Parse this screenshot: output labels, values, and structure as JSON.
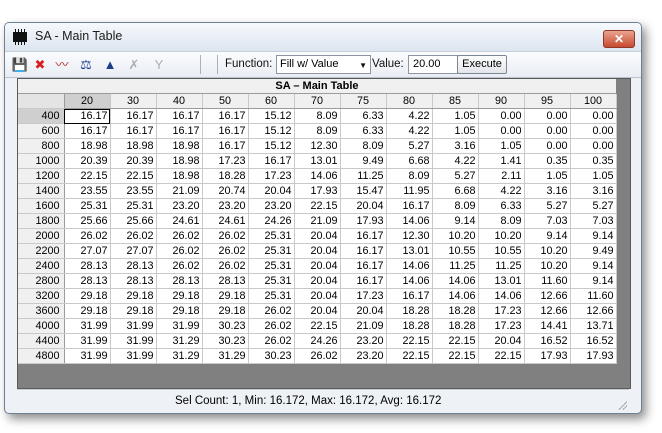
{
  "window": {
    "title": "SA - Main Table",
    "close_label": "✕"
  },
  "toolbar": {
    "buttons": [
      {
        "name": "save-button",
        "icon": "save-icon",
        "glyph": "💾"
      },
      {
        "name": "delete-button",
        "icon": "red-x-icon",
        "glyph": "✖"
      },
      {
        "name": "graph-button",
        "icon": "graph-icon",
        "glyph": "〰"
      },
      {
        "name": "balance-button",
        "icon": "scale-icon",
        "glyph": "⚖"
      },
      {
        "name": "triangle-button",
        "icon": "triangle-icon",
        "glyph": "▲"
      },
      {
        "name": "disabled-a-button",
        "icon": "ax-icon",
        "glyph": "✗"
      },
      {
        "name": "disabled-y-button",
        "icon": "y-icon",
        "glyph": "Y"
      }
    ],
    "function_label": "Function:",
    "function_value": "Fill w/ Value",
    "value_label": "Value:",
    "value_input": "20.00",
    "execute_label": "Execute"
  },
  "table": {
    "title": "SA – Main Table",
    "columns": [
      "20",
      "30",
      "40",
      "50",
      "60",
      "70",
      "75",
      "80",
      "85",
      "90",
      "95",
      "100"
    ],
    "rows": [
      {
        "label": "400",
        "values": [
          "16.17",
          "16.17",
          "16.17",
          "16.17",
          "15.12",
          "8.09",
          "6.33",
          "4.22",
          "1.05",
          "0.00",
          "0.00",
          "0.00"
        ]
      },
      {
        "label": "600",
        "values": [
          "16.17",
          "16.17",
          "16.17",
          "16.17",
          "15.12",
          "8.09",
          "6.33",
          "4.22",
          "1.05",
          "0.00",
          "0.00",
          "0.00"
        ]
      },
      {
        "label": "800",
        "values": [
          "18.98",
          "18.98",
          "18.98",
          "16.17",
          "15.12",
          "12.30",
          "8.09",
          "5.27",
          "3.16",
          "1.05",
          "0.00",
          "0.00"
        ]
      },
      {
        "label": "1000",
        "values": [
          "20.39",
          "20.39",
          "18.98",
          "17.23",
          "16.17",
          "13.01",
          "9.49",
          "6.68",
          "4.22",
          "1.41",
          "0.35",
          "0.35"
        ]
      },
      {
        "label": "1200",
        "values": [
          "22.15",
          "22.15",
          "18.98",
          "18.28",
          "17.23",
          "14.06",
          "11.25",
          "8.09",
          "5.27",
          "2.11",
          "1.05",
          "1.05"
        ]
      },
      {
        "label": "1400",
        "values": [
          "23.55",
          "23.55",
          "21.09",
          "20.74",
          "20.04",
          "17.93",
          "15.47",
          "11.95",
          "6.68",
          "4.22",
          "3.16",
          "3.16"
        ]
      },
      {
        "label": "1600",
        "values": [
          "25.31",
          "25.31",
          "23.20",
          "23.20",
          "23.20",
          "22.15",
          "20.04",
          "16.17",
          "8.09",
          "6.33",
          "5.27",
          "5.27"
        ]
      },
      {
        "label": "1800",
        "values": [
          "25.66",
          "25.66",
          "24.61",
          "24.61",
          "24.26",
          "21.09",
          "17.93",
          "14.06",
          "9.14",
          "8.09",
          "7.03",
          "7.03"
        ]
      },
      {
        "label": "2000",
        "values": [
          "26.02",
          "26.02",
          "26.02",
          "26.02",
          "25.31",
          "20.04",
          "16.17",
          "12.30",
          "10.20",
          "10.20",
          "9.14",
          "9.14"
        ]
      },
      {
        "label": "2200",
        "values": [
          "27.07",
          "27.07",
          "26.02",
          "26.02",
          "25.31",
          "20.04",
          "16.17",
          "13.01",
          "10.55",
          "10.55",
          "10.20",
          "9.49"
        ]
      },
      {
        "label": "2400",
        "values": [
          "28.13",
          "28.13",
          "26.02",
          "26.02",
          "25.31",
          "20.04",
          "16.17",
          "14.06",
          "11.25",
          "11.25",
          "10.20",
          "9.14"
        ]
      },
      {
        "label": "2800",
        "values": [
          "28.13",
          "28.13",
          "28.13",
          "28.13",
          "25.31",
          "20.04",
          "16.17",
          "14.06",
          "14.06",
          "13.01",
          "11.60",
          "9.14"
        ]
      },
      {
        "label": "3200",
        "values": [
          "29.18",
          "29.18",
          "29.18",
          "29.18",
          "25.31",
          "20.04",
          "17.23",
          "16.17",
          "14.06",
          "14.06",
          "12.66",
          "11.60"
        ]
      },
      {
        "label": "3600",
        "values": [
          "29.18",
          "29.18",
          "29.18",
          "29.18",
          "26.02",
          "20.04",
          "20.04",
          "18.28",
          "18.28",
          "17.23",
          "12.66",
          "12.66"
        ]
      },
      {
        "label": "4000",
        "values": [
          "31.99",
          "31.99",
          "31.99",
          "30.23",
          "26.02",
          "22.15",
          "21.09",
          "18.28",
          "18.28",
          "17.23",
          "14.41",
          "13.71"
        ]
      },
      {
        "label": "4400",
        "values": [
          "31.99",
          "31.99",
          "31.29",
          "30.23",
          "26.02",
          "24.26",
          "23.20",
          "22.15",
          "22.15",
          "20.04",
          "16.52",
          "16.52"
        ]
      },
      {
        "label": "4800",
        "values": [
          "31.99",
          "31.99",
          "31.29",
          "31.29",
          "30.23",
          "26.02",
          "23.20",
          "22.15",
          "22.15",
          "22.15",
          "17.93",
          "17.93"
        ]
      }
    ]
  },
  "status": {
    "text": "Sel Count: 1, Min: 16.172, Max: 16.172, Avg: 16.172"
  }
}
